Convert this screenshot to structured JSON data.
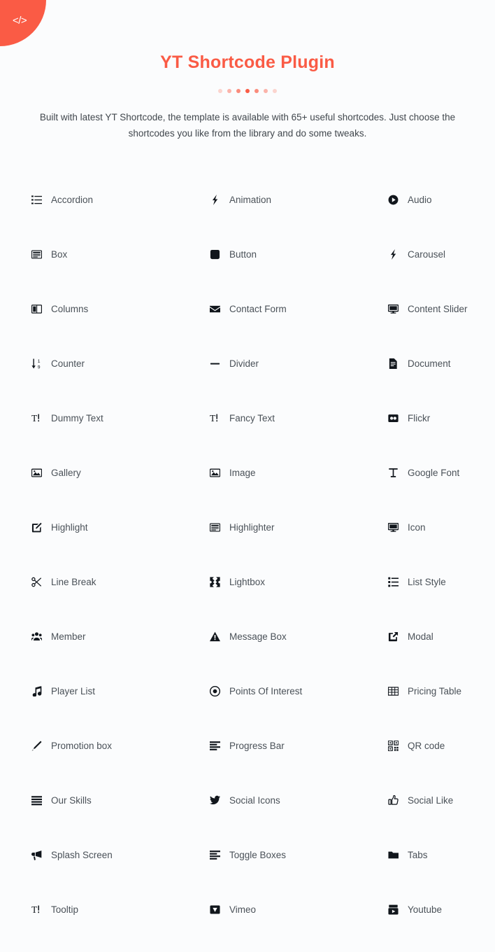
{
  "badge": {
    "icon": "code-icon",
    "glyph": "</>",
    "color": "#fa5b45"
  },
  "header": {
    "title": "YT Shortcode Plugin",
    "title_color": "#fa5b45",
    "description": "Built with latest YT Shortcode, the template is available with 65+ useful shortcodes.  Just choose the shortcodes you like from the library and do some tweaks.",
    "dots": [
      {
        "opacity": 0.25
      },
      {
        "opacity": 0.45
      },
      {
        "opacity": 0.7
      },
      {
        "opacity": 1
      },
      {
        "opacity": 0.7
      },
      {
        "opacity": 0.45
      },
      {
        "opacity": 0.25
      }
    ]
  },
  "shortcodes": [
    {
      "label": "Accordion",
      "icon": "list-lines-icon"
    },
    {
      "label": "Animation",
      "icon": "bolt-icon"
    },
    {
      "label": "Audio",
      "icon": "play-circle-icon"
    },
    {
      "label": "Box",
      "icon": "window-box-icon"
    },
    {
      "label": "Button",
      "icon": "rounded-square-icon"
    },
    {
      "label": "Carousel",
      "icon": "bolt-icon"
    },
    {
      "label": "Columns",
      "icon": "columns-icon"
    },
    {
      "label": "Contact Form",
      "icon": "envelope-icon"
    },
    {
      "label": "Content Slider",
      "icon": "desktop-icon"
    },
    {
      "label": "Counter",
      "icon": "sort-numeric-down-icon"
    },
    {
      "label": "Divider",
      "icon": "minus-icon"
    },
    {
      "label": "Document",
      "icon": "file-text-icon"
    },
    {
      "label": "Dummy Text",
      "icon": "text-height-icon"
    },
    {
      "label": "Fancy Text",
      "icon": "text-height-icon"
    },
    {
      "label": "Flickr",
      "icon": "flickr-icon"
    },
    {
      "label": "Gallery",
      "icon": "image-icon"
    },
    {
      "label": "Image",
      "icon": "image-icon"
    },
    {
      "label": "Google Font",
      "icon": "font-icon"
    },
    {
      "label": "Highlight",
      "icon": "pen-square-icon"
    },
    {
      "label": "Highlighter",
      "icon": "window-box-icon"
    },
    {
      "label": "Icon",
      "icon": "desktop-icon"
    },
    {
      "label": "Line Break",
      "icon": "scissors-icon"
    },
    {
      "label": "Lightbox",
      "icon": "expand-arrows-icon"
    },
    {
      "label": "List Style",
      "icon": "list-ol-icon"
    },
    {
      "label": "Member",
      "icon": "users-icon"
    },
    {
      "label": "Message Box",
      "icon": "warning-triangle-icon"
    },
    {
      "label": "Modal",
      "icon": "external-link-icon"
    },
    {
      "label": "Player List",
      "icon": "music-note-icon"
    },
    {
      "label": "Points Of Interest",
      "icon": "dot-circle-icon"
    },
    {
      "label": "Pricing Table",
      "icon": "table-grid-icon"
    },
    {
      "label": "Promotion box",
      "icon": "pencil-icon"
    },
    {
      "label": "Progress Bar",
      "icon": "align-bars-icon"
    },
    {
      "label": "QR code",
      "icon": "qrcode-icon"
    },
    {
      "label": "Our Skills",
      "icon": "align-justify-icon"
    },
    {
      "label": "Social Icons",
      "icon": "twitter-bird-icon"
    },
    {
      "label": "Social Like",
      "icon": "thumbs-up-icon"
    },
    {
      "label": "Splash Screen",
      "icon": "bullhorn-icon"
    },
    {
      "label": "Toggle Boxes",
      "icon": "align-bars-icon"
    },
    {
      "label": "Tabs",
      "icon": "folder-icon"
    },
    {
      "label": "Tooltip",
      "icon": "text-height-icon"
    },
    {
      "label": "Vimeo",
      "icon": "vimeo-icon"
    },
    {
      "label": "Youtube",
      "icon": "youtube-icon"
    }
  ]
}
